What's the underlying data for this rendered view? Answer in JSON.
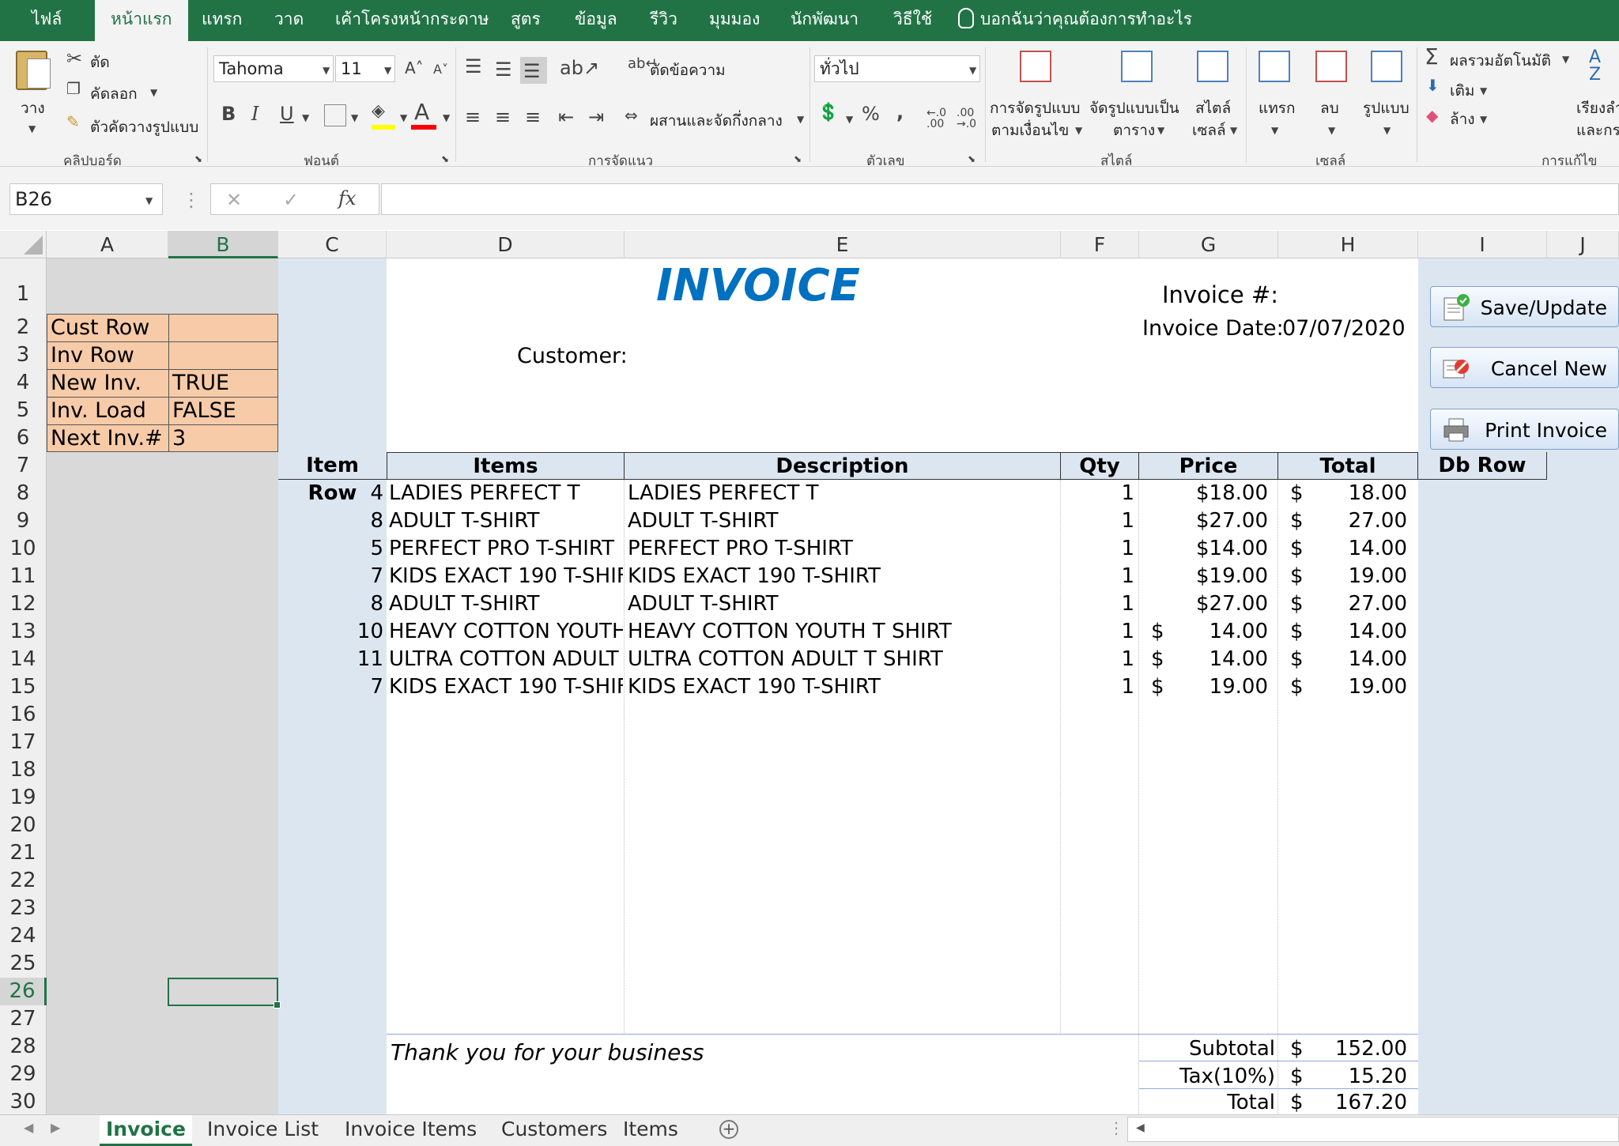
{
  "ribbon": {
    "tabs": [
      "ไฟล์",
      "หน้าแรก",
      "แทรก",
      "วาด",
      "เค้าโครงหน้ากระดาษ",
      "สูตร",
      "ข้อมูล",
      "รีวิว",
      "มุมมอง",
      "นักพัฒนา",
      "วิธีใช้"
    ],
    "tell_me": "บอกฉันว่าคุณต้องการทำอะไร",
    "clipboard": {
      "paste": "วาง",
      "cut": "ตัด",
      "copy": "คัดลอก",
      "format_painter": "ตัวคัดวางรูปแบบ",
      "group": "คลิปบอร์ด"
    },
    "font": {
      "name": "Tahoma",
      "size": "11",
      "bold": "B",
      "italic": "I",
      "underline": "U",
      "group": "ฟอนต์"
    },
    "alignment": {
      "wrap": "ตัดข้อความ",
      "merge": "ผสานและจัดกึ่งกลาง",
      "group": "การจัดแนว"
    },
    "number": {
      "format": "ทั่วไป",
      "percent": "%",
      "comma": ",",
      "group": "ตัวเลข"
    },
    "styles": {
      "conditional_1": "การจัดรูปแบบ",
      "conditional_2": "ตามเงื่อนไข",
      "table_1": "จัดรูปแบบเป็น",
      "table_2": "ตาราง",
      "cell_1": "สไตล์",
      "cell_2": "เซลล์",
      "group": "สไตล์"
    },
    "cells": {
      "insert": "แทรก",
      "delete": "ลบ",
      "format": "รูปแบบ",
      "group": "เซลล์"
    },
    "editing": {
      "autosum": "ผลรวมอัตโนมัติ",
      "fill": "เติม",
      "clear": "ล้าง",
      "sort_1": "เรียงลำ",
      "sort_2": "และกร",
      "group": "การแก้ไข"
    }
  },
  "formula_bar": {
    "name_box": "B26",
    "fx": "fx",
    "content": ""
  },
  "columns": [
    "A",
    "B",
    "C",
    "D",
    "E",
    "F",
    "G",
    "H",
    "I",
    "J"
  ],
  "rows": [
    "1",
    "2",
    "3",
    "4",
    "5",
    "6",
    "7",
    "8",
    "9",
    "10",
    "11",
    "12",
    "13",
    "14",
    "15",
    "16",
    "17",
    "18",
    "19",
    "20",
    "21",
    "22",
    "23",
    "24",
    "25",
    "26",
    "27",
    "28",
    "29",
    "30"
  ],
  "control_cells": [
    {
      "label": "Cust Row",
      "value": ""
    },
    {
      "label": "Inv Row",
      "value": ""
    },
    {
      "label": "New Inv.",
      "value": "TRUE"
    },
    {
      "label": "Inv. Load",
      "value": "FALSE"
    },
    {
      "label": "Next Inv.#",
      "value": "3"
    }
  ],
  "invoice": {
    "title": "INVOICE",
    "invoice_no_label": "Invoice #:",
    "invoice_date_label": "Invoice Date:",
    "invoice_date": "07/07/2020",
    "customer_label": "Customer:",
    "headers": {
      "item_row": "Item Row",
      "items": "Items",
      "description": "Description",
      "qty": "Qty",
      "price": "Price",
      "total": "Total",
      "db_row": "Db Row"
    },
    "lines": [
      {
        "row": "4",
        "item": "LADIES PERFECT T",
        "desc": "LADIES PERFECT T",
        "qty": "1",
        "price_sym": "",
        "price": "$18.00",
        "total": "18.00"
      },
      {
        "row": "8",
        "item": "ADULT T-SHIRT",
        "desc": "ADULT T-SHIRT",
        "qty": "1",
        "price_sym": "",
        "price": "$27.00",
        "total": "27.00"
      },
      {
        "row": "5",
        "item": "PERFECT PRO T-SHIRT",
        "desc": "PERFECT PRO T-SHIRT",
        "qty": "1",
        "price_sym": "",
        "price": "$14.00",
        "total": "14.00"
      },
      {
        "row": "7",
        "item": "KIDS EXACT 190 T-SHIF",
        "desc": "KIDS EXACT 190 T-SHIRT",
        "qty": "1",
        "price_sym": "",
        "price": "$19.00",
        "total": "19.00"
      },
      {
        "row": "8",
        "item": "ADULT T-SHIRT",
        "desc": "ADULT T-SHIRT",
        "qty": "1",
        "price_sym": "",
        "price": "$27.00",
        "total": "27.00"
      },
      {
        "row": "10",
        "item": "HEAVY COTTON YOUTH",
        "desc": "HEAVY COTTON YOUTH T SHIRT",
        "qty": "1",
        "price_sym": "$",
        "price": "14.00",
        "total": "14.00"
      },
      {
        "row": "11",
        "item": "ULTRA COTTON ADULT",
        "desc": "ULTRA COTTON ADULT T SHIRT",
        "qty": "1",
        "price_sym": "$",
        "price": "14.00",
        "total": "14.00"
      },
      {
        "row": "7",
        "item": "KIDS EXACT 190 T-SHIF",
        "desc": "KIDS EXACT 190 T-SHIRT",
        "qty": "1",
        "price_sym": "$",
        "price": "19.00",
        "total": "19.00"
      }
    ],
    "currency": "$",
    "thanks": "Thank you for your business",
    "subtotal_label": "Subtotal",
    "subtotal": "152.00",
    "tax_label": "Tax(10%)",
    "tax": "15.20",
    "total_label": "Total",
    "total": "167.20"
  },
  "buttons": {
    "save": "Save/Update",
    "cancel": "Cancel New",
    "print": "Print Invoice"
  },
  "sheets": [
    "Invoice",
    "Invoice List",
    "Invoice Items",
    "Customers",
    "Items"
  ],
  "colors": {
    "excel_green": "#217346",
    "title_blue": "#0070c0",
    "orange_fill": "#f8cba8",
    "header_fill": "#dce6f1"
  }
}
